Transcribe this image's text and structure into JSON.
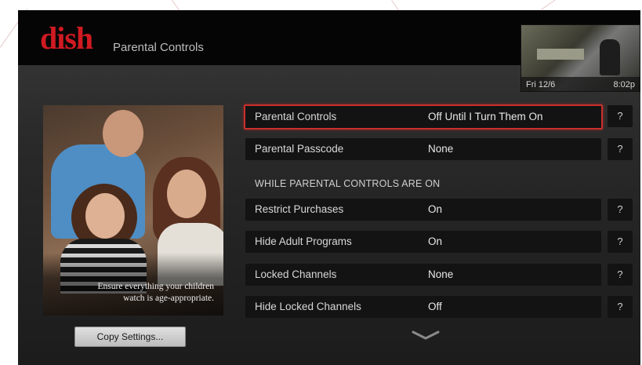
{
  "app": {
    "logo_text": "dish",
    "title": "Parental Controls"
  },
  "preview": {
    "date": "Fri 12/6",
    "time": "8:02p"
  },
  "promo": {
    "caption": "Ensure everything your children watch is age-appropriate."
  },
  "actions": {
    "copy_settings": "Copy Settings..."
  },
  "settings": {
    "section_header": "WHILE PARENTAL CONTROLS ARE ON",
    "help_label": "?",
    "rows": [
      {
        "label": "Parental Controls",
        "value": "Off Until I Turn Them On",
        "selected": true
      },
      {
        "label": "Parental Passcode",
        "value": "None",
        "selected": false
      },
      {
        "label": "Restrict Purchases",
        "value": "On",
        "selected": false
      },
      {
        "label": "Hide Adult Programs",
        "value": "On",
        "selected": false
      },
      {
        "label": "Locked Channels",
        "value": "None",
        "selected": false
      },
      {
        "label": "Hide Locked Channels",
        "value": "Off",
        "selected": false
      }
    ]
  },
  "colors": {
    "brand_red": "#d01a22",
    "selection_border": "#c9302c"
  },
  "icons": {
    "scroll_down": "chevron-down-icon"
  }
}
